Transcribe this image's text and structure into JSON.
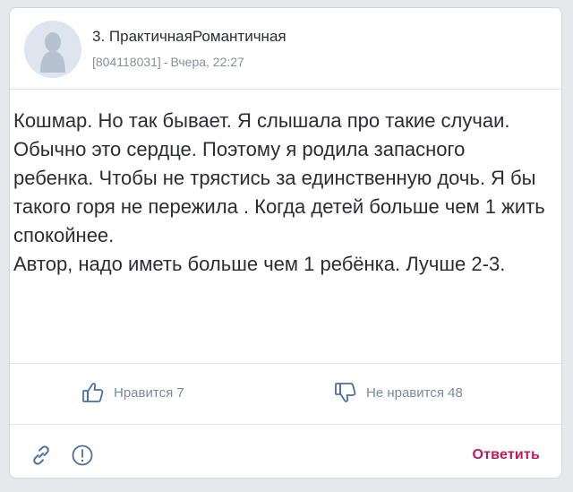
{
  "post": {
    "author": "3. ПрактичнаяРомантичная",
    "user_id": "[804118031]",
    "separator": "-",
    "timestamp": "Вчера, 22:27",
    "body": [
      "Кошмар. Но так бывает. Я слышала про такие случаи. Обычно это сердце. Поэтому я родила запасного ребенка. Чтобы не трястись за единственную дочь. Я бы такого горя не пережила . Когда детей больше чем 1 жить спокойнее.",
      "Автор, надо иметь больше чем 1 ребёнка. Лучше 2-3."
    ],
    "avatar_icon": "user-silhouette-icon"
  },
  "reactions": {
    "like_label": "Нравится 7",
    "like_icon": "thumbs-up-icon",
    "dislike_label": "Не нравится 48",
    "dislike_icon": "thumbs-down-icon"
  },
  "footer": {
    "link_icon": "link-icon",
    "report_icon": "report-icon",
    "reply_label": "Ответить"
  },
  "colors": {
    "accent": "#c2185b",
    "reaction": "#7a8a9a",
    "text": "#2b2d31",
    "meta": "#8a8f98"
  }
}
